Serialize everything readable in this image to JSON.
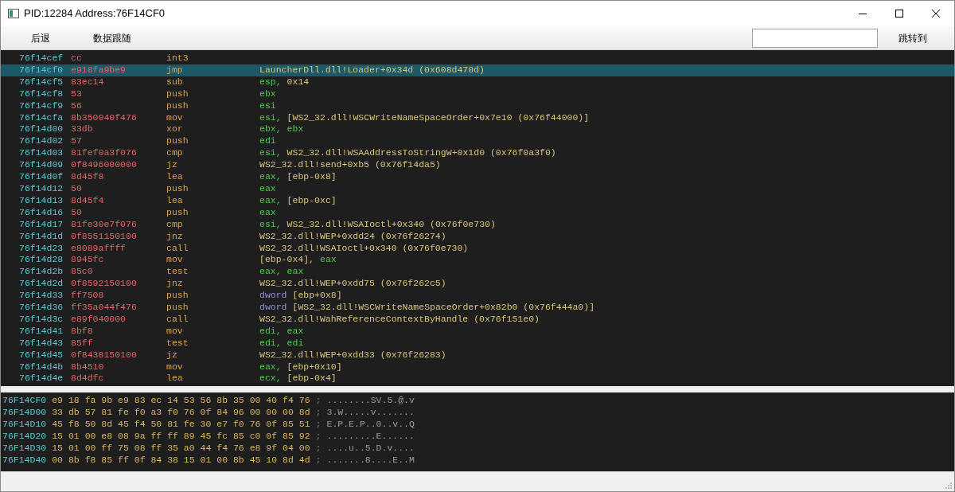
{
  "window": {
    "title": "PID:12284  Address:76F14CF0"
  },
  "toolbar": {
    "buttons": [
      "后退",
      "数据跟随"
    ],
    "jump_button": "跳转到"
  },
  "disassembly": [
    {
      "address": "76f14cef",
      "bytes": "cc",
      "mnemonic": "int3",
      "selected": false
    },
    {
      "address": "76f14cf0",
      "bytes": "e918fa9be9",
      "mnemonic": "jmp",
      "operands": [
        {
          "text": "LauncherDll.dll!Loader+0x34d (0x608d470d)",
          "kind": "mem"
        }
      ],
      "selected": true
    },
    {
      "address": "76f14cf5",
      "bytes": "83ec14",
      "mnemonic": "sub",
      "operands": [
        {
          "text": "esp,",
          "kind": "reg"
        },
        {
          "text": "0x14",
          "kind": "mem"
        }
      ],
      "selected": false
    },
    {
      "address": "76f14cf8",
      "bytes": "53",
      "mnemonic": "push",
      "operands": [
        {
          "text": "ebx",
          "kind": "reg"
        }
      ],
      "selected": false
    },
    {
      "address": "76f14cf9",
      "bytes": "56",
      "mnemonic": "push",
      "operands": [
        {
          "text": "esi",
          "kind": "reg"
        }
      ],
      "selected": false
    },
    {
      "address": "76f14cfa",
      "bytes": "8b350040f476",
      "mnemonic": "mov",
      "operands": [
        {
          "text": "esi,",
          "kind": "reg"
        },
        {
          "text": "[WS2_32.dll!WSCWriteNameSpaceOrder+0x7e10 (0x76f44000)]",
          "kind": "mem"
        }
      ],
      "selected": false
    },
    {
      "address": "76f14d00",
      "bytes": "33db",
      "mnemonic": "xor",
      "operands": [
        {
          "text": "ebx,",
          "kind": "reg"
        },
        {
          "text": "ebx",
          "kind": "reg"
        }
      ],
      "selected": false
    },
    {
      "address": "76f14d02",
      "bytes": "57",
      "mnemonic": "push",
      "operands": [
        {
          "text": "edi",
          "kind": "reg"
        }
      ],
      "selected": false
    },
    {
      "address": "76f14d03",
      "bytes": "81fef0a3f076",
      "mnemonic": "cmp",
      "operands": [
        {
          "text": "esi,",
          "kind": "reg"
        },
        {
          "text": "WS2_32.dll!WSAAddressToStringW+0x1d0 (0x76f0a3f0)",
          "kind": "mem"
        }
      ],
      "selected": false
    },
    {
      "address": "76f14d09",
      "bytes": "0f8496000000",
      "mnemonic": "jz",
      "operands": [
        {
          "text": "WS2_32.dll!send+0xb5 (0x76f14da5)",
          "kind": "mem"
        }
      ],
      "selected": false
    },
    {
      "address": "76f14d0f",
      "bytes": "8d45f8",
      "mnemonic": "lea",
      "operands": [
        {
          "text": "eax,",
          "kind": "reg"
        },
        {
          "text": "[ebp-0x8]",
          "kind": "mem"
        }
      ],
      "selected": false
    },
    {
      "address": "76f14d12",
      "bytes": "50",
      "mnemonic": "push",
      "operands": [
        {
          "text": "eax",
          "kind": "reg"
        }
      ],
      "selected": false
    },
    {
      "address": "76f14d13",
      "bytes": "8d45f4",
      "mnemonic": "lea",
      "operands": [
        {
          "text": "eax,",
          "kind": "reg"
        },
        {
          "text": "[ebp-0xc]",
          "kind": "mem"
        }
      ],
      "selected": false
    },
    {
      "address": "76f14d16",
      "bytes": "50",
      "mnemonic": "push",
      "operands": [
        {
          "text": "eax",
          "kind": "reg"
        }
      ],
      "selected": false
    },
    {
      "address": "76f14d17",
      "bytes": "81fe30e7f076",
      "mnemonic": "cmp",
      "operands": [
        {
          "text": "esi,",
          "kind": "reg"
        },
        {
          "text": "WS2_32.dll!WSAIoctl+0x340 (0x76f0e730)",
          "kind": "mem"
        }
      ],
      "selected": false
    },
    {
      "address": "76f14d1d",
      "bytes": "0f8551150100",
      "mnemonic": "jnz",
      "operands": [
        {
          "text": "WS2_32.dll!WEP+0xdd24 (0x76f26274)",
          "kind": "mem"
        }
      ],
      "selected": false
    },
    {
      "address": "76f14d23",
      "bytes": "e8089affff",
      "mnemonic": "call",
      "operands": [
        {
          "text": "WS2_32.dll!WSAIoctl+0x340 (0x76f0e730)",
          "kind": "mem"
        }
      ],
      "selected": false
    },
    {
      "address": "76f14d28",
      "bytes": "8945fc",
      "mnemonic": "mov",
      "operands": [
        {
          "text": "[ebp-0x4],",
          "kind": "mem"
        },
        {
          "text": "eax",
          "kind": "reg"
        }
      ],
      "selected": false
    },
    {
      "address": "76f14d2b",
      "bytes": "85c0",
      "mnemonic": "test",
      "operands": [
        {
          "text": "eax,",
          "kind": "reg"
        },
        {
          "text": "eax",
          "kind": "reg"
        }
      ],
      "selected": false
    },
    {
      "address": "76f14d2d",
      "bytes": "0f8592150100",
      "mnemonic": "jnz",
      "operands": [
        {
          "text": "WS2_32.dll!WEP+0xdd75 (0x76f262c5)",
          "kind": "mem"
        }
      ],
      "selected": false
    },
    {
      "address": "76f14d33",
      "bytes": "ff7508",
      "mnemonic": "push",
      "operands": [
        {
          "text": "dword",
          "kind": "size"
        },
        {
          "text": "[ebp+0x8]",
          "kind": "mem"
        }
      ],
      "selected": false
    },
    {
      "address": "76f14d36",
      "bytes": "ff35a044f476",
      "mnemonic": "push",
      "operands": [
        {
          "text": "dword",
          "kind": "size"
        },
        {
          "text": "[WS2_32.dll!WSCWriteNameSpaceOrder+0x82b0 (0x76f444a0)]",
          "kind": "mem"
        }
      ],
      "selected": false
    },
    {
      "address": "76f14d3c",
      "bytes": "e89f040000",
      "mnemonic": "call",
      "operands": [
        {
          "text": "WS2_32.dll!WahReferenceContextByHandle (0x76f151e0)",
          "kind": "mem"
        }
      ],
      "selected": false
    },
    {
      "address": "76f14d41",
      "bytes": "8bf8",
      "mnemonic": "mov",
      "operands": [
        {
          "text": "edi,",
          "kind": "reg"
        },
        {
          "text": "eax",
          "kind": "reg"
        }
      ],
      "selected": false
    },
    {
      "address": "76f14d43",
      "bytes": "85ff",
      "mnemonic": "test",
      "operands": [
        {
          "text": "edi,",
          "kind": "reg"
        },
        {
          "text": "edi",
          "kind": "reg"
        }
      ],
      "selected": false
    },
    {
      "address": "76f14d45",
      "bytes": "0f8438150100",
      "mnemonic": "jz",
      "operands": [
        {
          "text": "WS2_32.dll!WEP+0xdd33 (0x76f26283)",
          "kind": "mem"
        }
      ],
      "selected": false
    },
    {
      "address": "76f14d4b",
      "bytes": "8b4510",
      "mnemonic": "mov",
      "operands": [
        {
          "text": "eax,",
          "kind": "reg"
        },
        {
          "text": "[ebp+0x10]",
          "kind": "mem"
        }
      ],
      "selected": false
    },
    {
      "address": "76f14d4e",
      "bytes": "8d4dfc",
      "mnemonic": "lea",
      "operands": [
        {
          "text": "ecx,",
          "kind": "reg"
        },
        {
          "text": "[ebp-0x4]",
          "kind": "mem"
        }
      ],
      "selected": false
    }
  ],
  "hex_dump": [
    {
      "address": "76F14CF0",
      "bytes": "e9 18 fa 9b e9 83 ec 14 53 56 8b 35 00 40 f4 76",
      "separator": ";",
      "ascii": "........SV.5.@.v"
    },
    {
      "address": "76F14D00",
      "bytes": "33 db 57 81 fe f0 a3 f0 76 0f 84 96 00 00 00 8d",
      "separator": ";",
      "ascii": "3.W.....v......."
    },
    {
      "address": "76F14D10",
      "bytes": "45 f8 50 8d 45 f4 50 81 fe 30 e7 f0 76 0f 85 51",
      "separator": ";",
      "ascii": "E.P.E.P..0..v..Q"
    },
    {
      "address": "76F14D20",
      "bytes": "15 01 00 e8 08 9a ff ff 89 45 fc 85 c0 0f 85 92",
      "separator": ";",
      "ascii": ".........E......"
    },
    {
      "address": "76F14D30",
      "bytes": "15 01 00 ff 75 08 ff 35 a0 44 f4 76 e8 9f 04 00",
      "separator": ";",
      "ascii": "....u..5.D.v...."
    },
    {
      "address": "76F14D40",
      "bytes": "00 8b f8 85 ff 0f 84 38 15 01 00 8b 45 10 8d 4d",
      "separator": ";",
      "ascii": ".......8....E..M"
    }
  ]
}
